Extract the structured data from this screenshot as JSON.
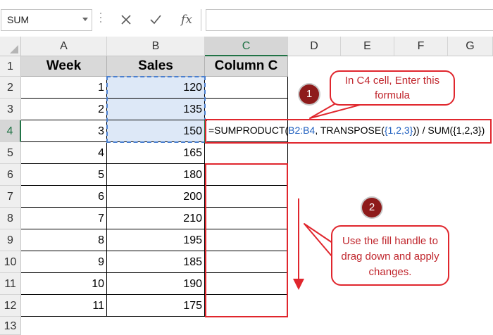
{
  "formula_bar": {
    "name_box": "SUM",
    "cancel_icon": "x-icon",
    "enter_icon": "checkmark-icon",
    "insert_function_label": "fx"
  },
  "columns": [
    "A",
    "B",
    "C",
    "D",
    "E",
    "F",
    "G"
  ],
  "rows": [
    "1",
    "2",
    "3",
    "4",
    "5",
    "6",
    "7",
    "8",
    "9",
    "10",
    "11",
    "12",
    "13"
  ],
  "sheet": {
    "headers": {
      "week": "Week",
      "sales": "Sales",
      "col_c": "Column C"
    },
    "data": [
      {
        "week": "1",
        "sales": "120"
      },
      {
        "week": "2",
        "sales": "135"
      },
      {
        "week": "3",
        "sales": "150"
      },
      {
        "week": "4",
        "sales": "165"
      },
      {
        "week": "5",
        "sales": "180"
      },
      {
        "week": "6",
        "sales": "200"
      },
      {
        "week": "7",
        "sales": "210"
      },
      {
        "week": "8",
        "sales": "195"
      },
      {
        "week": "9",
        "sales": "185"
      },
      {
        "week": "10",
        "sales": "190"
      },
      {
        "week": "11",
        "sales": "175"
      }
    ]
  },
  "formula": {
    "prefix": "=SUMPRODUCT(",
    "range_ref": "B2:B4",
    "middle": ", TRANSPOSE(",
    "arg": "{1,2,3}",
    "suffix": ")) / SUM({1,2,3})"
  },
  "annotations": {
    "step1_badge": "1",
    "step1_text": "In C4 cell, Enter this formula",
    "step2_badge": "2",
    "step2_text": "Use the fill handle to drag down and apply changes."
  },
  "colors": {
    "accent_green": "#217346",
    "annotation_red": "#e0262d",
    "badge_dark_red": "#8e1b1b",
    "ref_blue": "#1f5fbf"
  }
}
